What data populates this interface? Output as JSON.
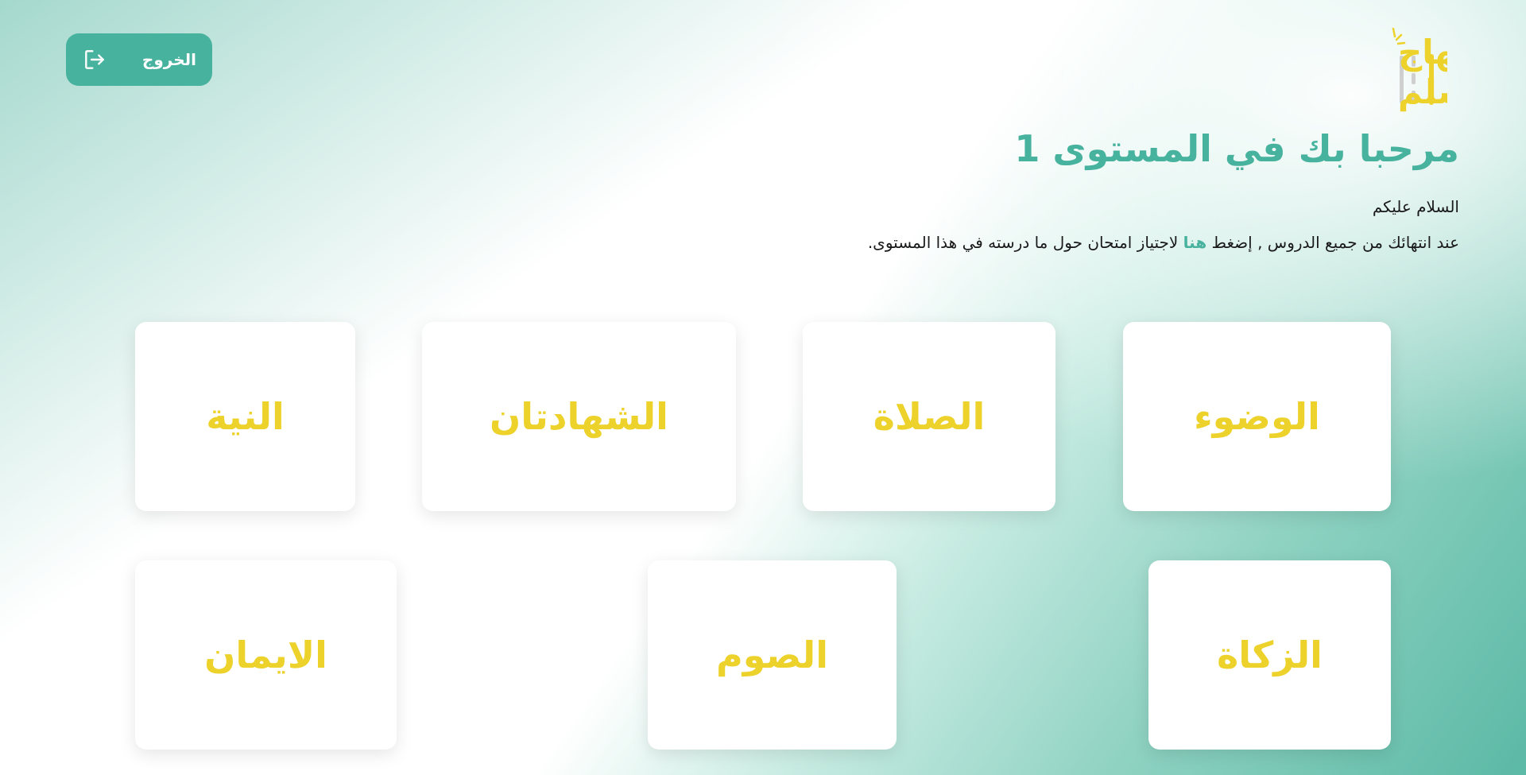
{
  "header": {
    "logout_label": "الخروج",
    "logo_text_top": "منهاج",
    "logo_text_bottom": "المسلم"
  },
  "main": {
    "title": "مرحبا بك في المستوى 1",
    "greeting": "السلام عليكم",
    "instructions_before": "عند انتهائك من جميع الدروس , إضغط ",
    "instructions_link": "هنا",
    "instructions_after": " لاجتياز امتحان حول ما درسته في هذا المستوى."
  },
  "lessons": {
    "row1": [
      "الوضوء",
      "الصلاة",
      "الشهادتان",
      "النية"
    ],
    "row2": [
      "الزكاة",
      "الصوم",
      "الايمان"
    ]
  },
  "colors": {
    "accent": "#47b29d",
    "card_text": "#ecd22a"
  }
}
